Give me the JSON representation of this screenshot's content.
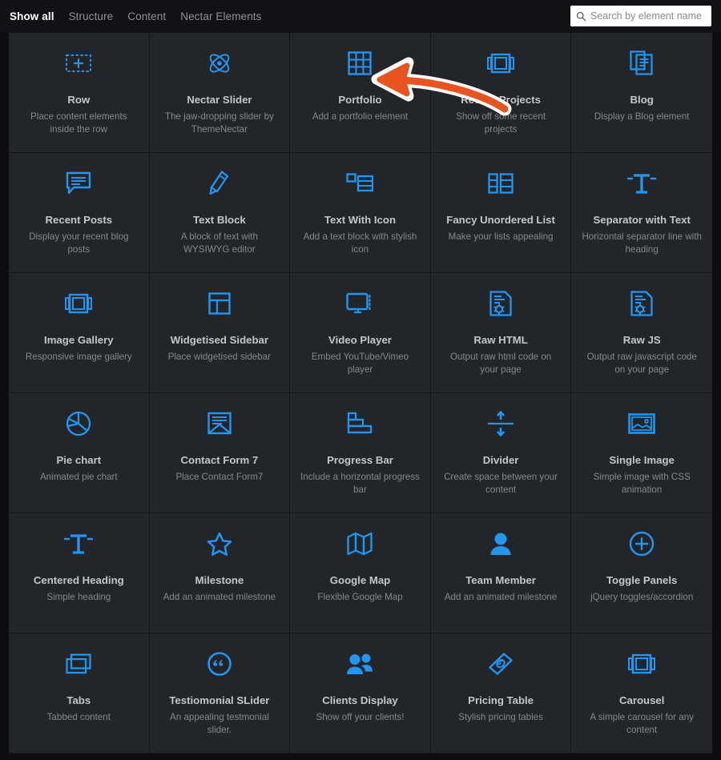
{
  "header": {
    "tabs": [
      {
        "label": "Show all",
        "active": true
      },
      {
        "label": "Structure",
        "active": false
      },
      {
        "label": "Content",
        "active": false
      },
      {
        "label": "Nectar Elements",
        "active": false
      }
    ],
    "search": {
      "placeholder": "Search by element name",
      "value": "",
      "icon": "search-icon"
    }
  },
  "grid": {
    "columns": 5,
    "items": [
      {
        "icon": "dashed-square-plus-icon",
        "title": "Row",
        "desc": "Place content elements inside the row"
      },
      {
        "icon": "atom-icon",
        "title": "Nectar Slider",
        "desc": "The jaw-dropping slider by ThemeNectar"
      },
      {
        "icon": "grid-table-icon",
        "title": "Portfolio",
        "desc": "Add a portfolio element"
      },
      {
        "icon": "slide-frame-icon",
        "title": "Recent Projects",
        "desc": "Show off some recent projects"
      },
      {
        "icon": "documents-icon",
        "title": "Blog",
        "desc": "Display a Blog element"
      },
      {
        "icon": "speech-bubble-icon",
        "title": "Recent Posts",
        "desc": "Display your recent blog posts"
      },
      {
        "icon": "pencil-icon",
        "title": "Text Block",
        "desc": "A block of text with WYSIWYG editor"
      },
      {
        "icon": "text-with-icon-icon",
        "title": "Text With Icon",
        "desc": "Add a text block with stylish icon"
      },
      {
        "icon": "list-columns-icon",
        "title": "Fancy Unordered List",
        "desc": "Make your lists appealing"
      },
      {
        "icon": "separator-t-icon",
        "title": "Separator with Text",
        "desc": "Horizontal separator line with heading"
      },
      {
        "icon": "slide-frame-icon",
        "title": "Image Gallery",
        "desc": "Responsive image gallery"
      },
      {
        "icon": "sidebar-layout-icon",
        "title": "Widgetised Sidebar",
        "desc": "Place widgetised sidebar"
      },
      {
        "icon": "monitor-icon",
        "title": "Video Player",
        "desc": "Embed YouTube/Vimeo player"
      },
      {
        "icon": "code-file-icon",
        "title": "Raw HTML",
        "desc": "Output raw html code on your page"
      },
      {
        "icon": "code-file-icon",
        "title": "Raw JS",
        "desc": "Output raw javascript code on your page"
      },
      {
        "icon": "pie-chart-icon",
        "title": "Pie chart",
        "desc": "Animated pie chart"
      },
      {
        "icon": "envelope-icon",
        "title": "Contact Form 7",
        "desc": "Place Contact Form7"
      },
      {
        "icon": "bar-steps-icon",
        "title": "Progress Bar",
        "desc": "Include a horizontal progress bar"
      },
      {
        "icon": "divider-arrows-icon",
        "title": "Divider",
        "desc": "Create space between your content"
      },
      {
        "icon": "picture-frame-icon",
        "title": "Single Image",
        "desc": "Simple image with CSS animation"
      },
      {
        "icon": "separator-t-icon",
        "title": "Centered Heading",
        "desc": "Simple heading"
      },
      {
        "icon": "star-icon",
        "title": "Milestone",
        "desc": "Add an animated milestone"
      },
      {
        "icon": "map-icon",
        "title": "Google Map",
        "desc": "Flexible Google Map"
      },
      {
        "icon": "person-icon",
        "title": "Team Member",
        "desc": "Add an animated milestone"
      },
      {
        "icon": "circle-plus-icon",
        "title": "Toggle Panels",
        "desc": "jQuery toggles/accordion"
      },
      {
        "icon": "windows-stack-icon",
        "title": "Tabs",
        "desc": "Tabbed content"
      },
      {
        "icon": "quote-circle-icon",
        "title": "Testiomonial SLider",
        "desc": "An appealing testmonial slider."
      },
      {
        "icon": "people-icon",
        "title": "Clients Display",
        "desc": "Show off your clients!"
      },
      {
        "icon": "money-tag-icon",
        "title": "Pricing Table",
        "desc": "Stylish pricing tables"
      },
      {
        "icon": "slide-frame-icon",
        "title": "Carousel",
        "desc": "A simple carousel for any content"
      }
    ]
  },
  "annotation": {
    "type": "curved-arrow",
    "points_from": "Recent Projects",
    "points_to": "Portfolio",
    "color": "#e8541f",
    "outline_color": "#ffffff"
  },
  "colors": {
    "page_background": "#0d0d0f",
    "header_background": "#121214",
    "card_background": "#232528",
    "card_border": "#141517",
    "icon_accent": "#2196f3",
    "title_text": "#c3c7cb",
    "desc_text": "#85898e",
    "active_tab_text": "#ffffff",
    "inactive_tab_text": "#8d9196"
  }
}
